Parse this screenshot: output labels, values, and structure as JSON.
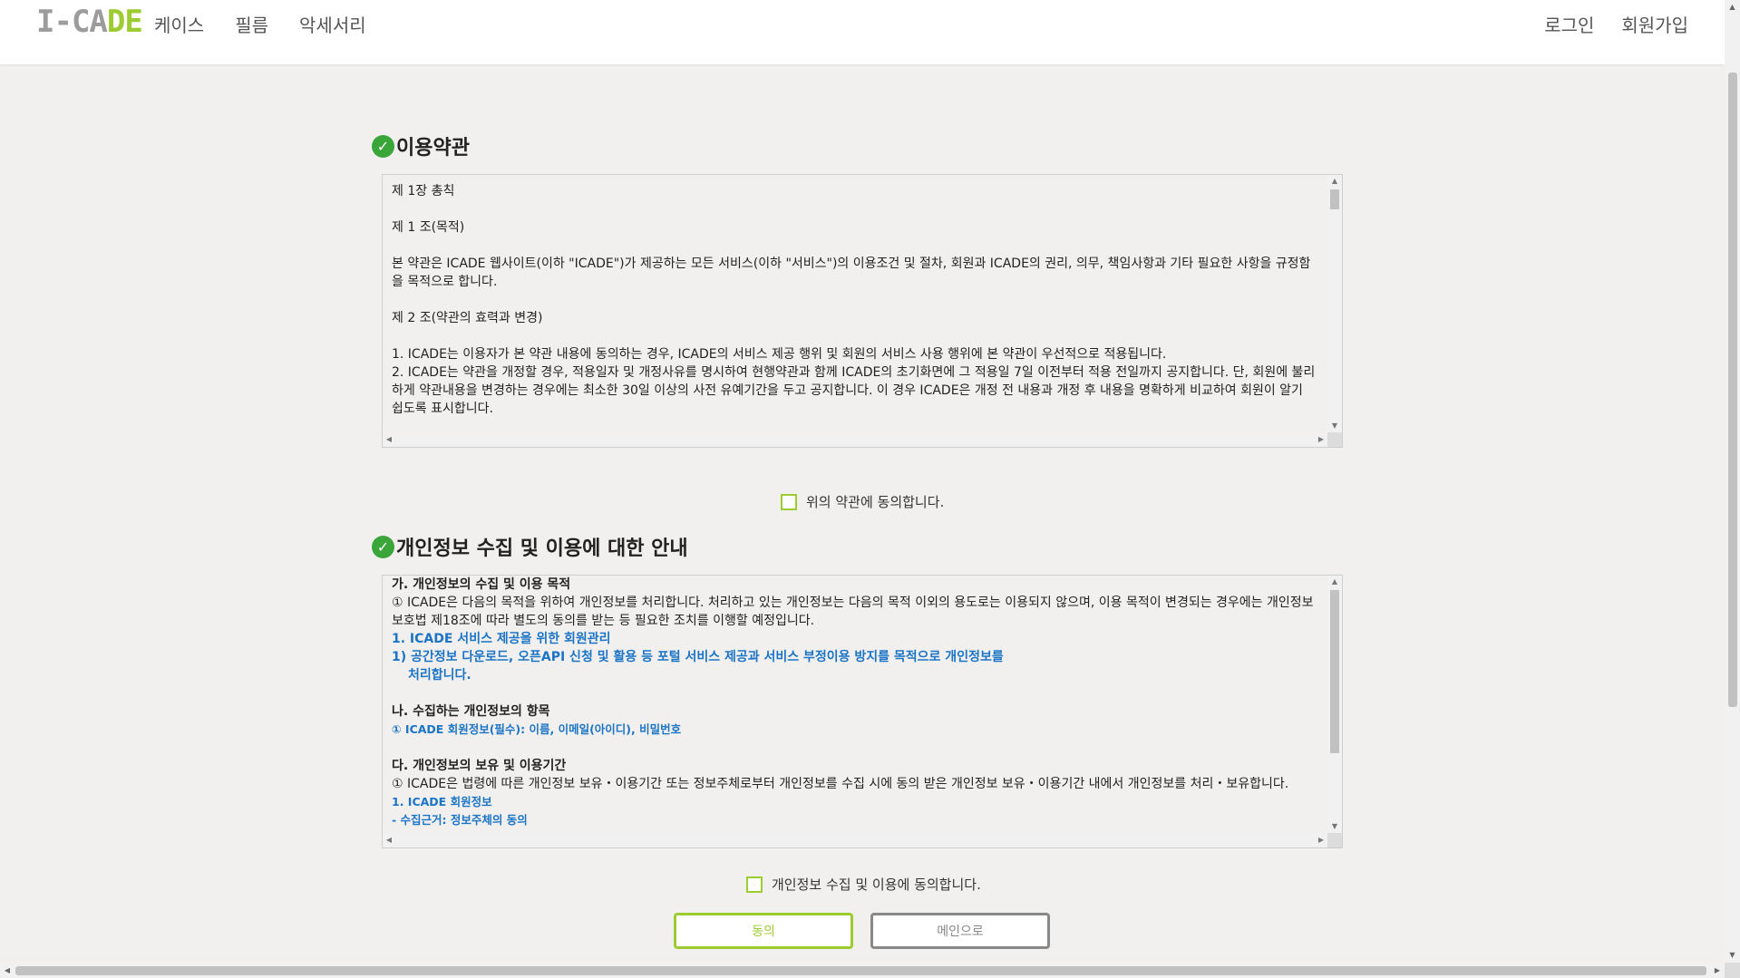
{
  "header": {
    "logo_part1": "I-",
    "logo_part2": "CA",
    "logo_part3": "DE",
    "nav": [
      "케이스",
      "필름",
      "악세서리"
    ],
    "login": "로그인",
    "signup": "회원가입"
  },
  "terms": {
    "title": "이용약관",
    "lines": [
      "제 1장 총칙",
      "제 1 조(목적)",
      "본 약관은 ICADE 웹사이트(이하 \"ICADE\")가 제공하는 모든 서비스(이하 \"서비스\")의 이용조건 및 절차, 회원과 ICADE의 권리, 의무, 책임사항과 기타 필요한 사항을 규정함을 목적으로 합니다.",
      "제 2 조(약관의 효력과 변경)",
      "1. ICADE는 이용자가 본 약관 내용에 동의하는 경우, ICADE의 서비스 제공 행위 및 회원의 서비스 사용 행위에 본 약관이 우선적으로 적용됩니다.",
      "2. ICADE는 약관을 개정할 경우, 적용일자 및 개정사유를 명시하여 현행약관과 함께 ICADE의 초기화면에 그 적용일 7일 이전부터 적용 전일까지 공지합니다. 단, 회원에 불리하게 약관내용을 변경하는 경우에는 최소한 30일 이상의 사전 유예기간을 두고 공지합니다. 이 경우 ICADE은 개정 전 내용과 개정 후 내용을 명확하게 비교하여 회원이 알기 쉽도록 표시합니다."
    ],
    "agree_label": "위의 약관에 동의합니다."
  },
  "privacy": {
    "title": "개인정보 수집 및 이용에 대한 안내",
    "h1": "가. 개인정보의 수집 및 이용 목적",
    "p1": "① ICADE은 다음의 목적을 위하여 개인정보를 처리합니다. 처리하고 있는 개인정보는 다음의 목적 이외의 용도로는 이용되지 않으며, 이용 목적이 변경되는 경우에는 개인정보 보호법 제18조에 따라 별도의 동의를 받는 등 필요한 조치를 이행할 예정입니다.",
    "b1": "1. ICADE 서비스 제공을 위한 회원관리",
    "b2": "1) 공간정보 다운로드, 오픈API 신청 및 활용 등 포털 서비스 제공과 서비스 부정이용 방지를 목적으로 개인정보를",
    "b2b": "처리합니다.",
    "h2": "나. 수집하는 개인정보의 항목",
    "b3": "① ICADE 회원정보(필수): 이름, 이메일(아이디), 비밀번호",
    "h3": "다. 개인정보의 보유 및 이용기간",
    "p3": "① ICADE은 법령에 따른 개인정보 보유・이용기간 또는 정보주체로부터 개인정보를 수집 시에 동의 받은 개인정보 보유・이용기간 내에서 개인정보를 처리・보유합니다.",
    "b4": "1. ICADE 회원정보",
    "b5": "- 수집근거: 정보주체의 동의",
    "agree_label": "개인정보 수집 및 이용에 동의합니다."
  },
  "buttons": {
    "agree": "동의",
    "main": "메인으로"
  },
  "colors": {
    "accent_green": "#9ccc2f",
    "check_green": "#3aa63a",
    "link_blue": "#1b74c6"
  }
}
